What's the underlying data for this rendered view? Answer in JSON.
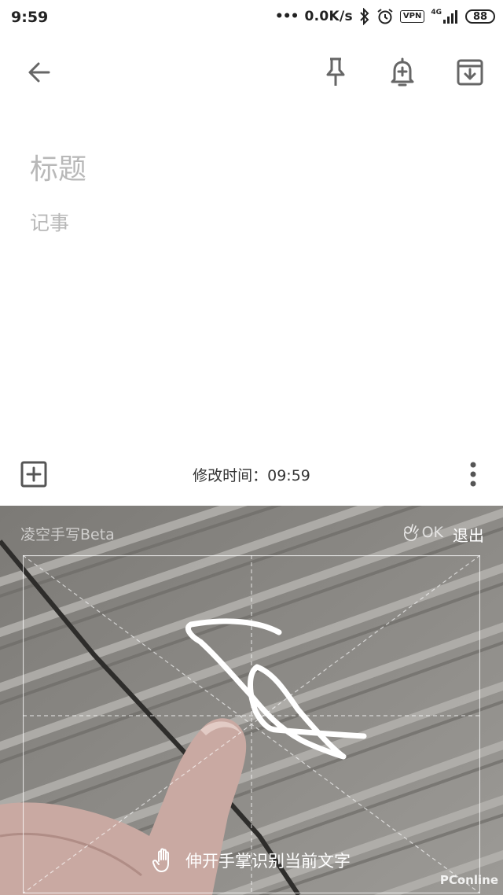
{
  "status_bar": {
    "time": "9:59",
    "dots": "•••",
    "network_speed": "0.0K/s",
    "icons": [
      "bluetooth-icon",
      "alarm-icon"
    ],
    "vpn": "VPN",
    "network_type": "4G",
    "battery": "88"
  },
  "toolbar": {
    "back_icon": "arrow-left-icon",
    "pin_icon": "pin-icon",
    "reminder_icon": "bell-plus-icon",
    "archive_icon": "archive-icon"
  },
  "note": {
    "title_placeholder": "标题",
    "body_placeholder": "记事"
  },
  "bottom_bar": {
    "add_icon": "plus-box-icon",
    "modified_time": "修改时间：09:59",
    "more_icon": "more-vert-icon"
  },
  "handwriting": {
    "mode_label": "凌空手写Beta",
    "ok_label": "OK",
    "exit_label": "退出",
    "hint": "伸开手掌识别当前文字",
    "watermark": "PConline"
  },
  "colors": {
    "icon": "#666666",
    "placeholder": "#b8b8b8",
    "overlay_bg": "#8d8b87",
    "stroke": "#ffffff"
  }
}
